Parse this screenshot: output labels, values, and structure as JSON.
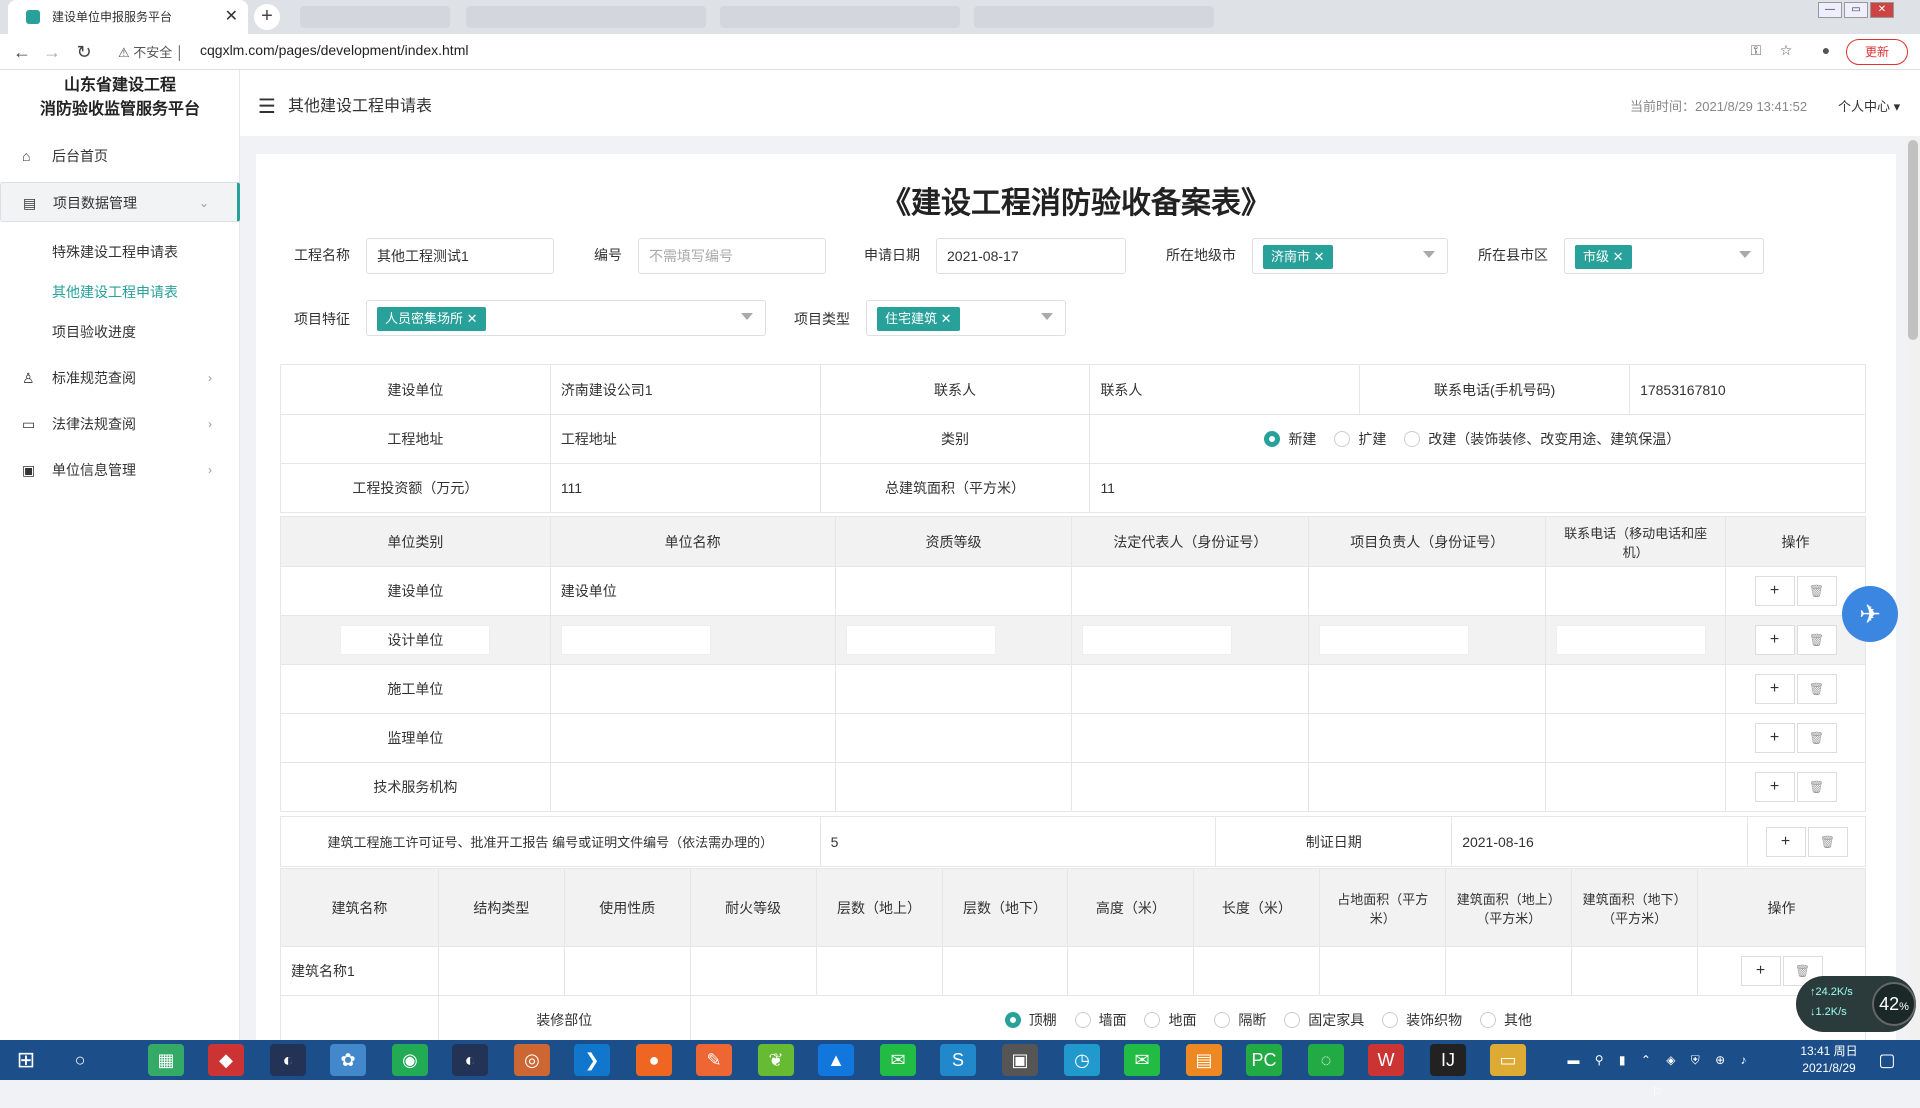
{
  "browser": {
    "tab_title": "建设单位申报服务平台",
    "secure_label": "不安全",
    "url": "cqgxlm.com/pages/development/index.html",
    "update_label": "更新"
  },
  "sidebar": {
    "logo_line1": "山东省建设工程",
    "logo_line2": "消防验收监管服务平台",
    "home": "后台首页",
    "project_mgmt": "项目数据管理",
    "sub_items": [
      "特殊建设工程申请表",
      "其他建设工程申请表",
      "项目验收进度"
    ],
    "standards": "标准规范查阅",
    "laws": "法律法规查阅",
    "unit_info": "单位信息管理"
  },
  "header": {
    "breadcrumb": "其他建设工程申请表",
    "time": "当前时间：2021/8/29 13:41:52",
    "user_menu": "个人中心 ▾"
  },
  "form": {
    "title": "《建设工程消防验收备案表》",
    "name_label": "工程名称",
    "name_value": "其他工程测试1",
    "no_label": "编号",
    "no_placeholder": "不需填写编号",
    "date_label": "申请日期",
    "date_value": "2021-08-17",
    "city_label": "所在地级市",
    "city_value": "济南市",
    "county_label": "所在县市区",
    "county_value": "市级",
    "feature_label": "项目特征",
    "feature_value": "人员密集场所",
    "type_label": "项目类型",
    "type_value": "住宅建筑"
  },
  "info_table": {
    "r1": [
      "建设单位",
      "济南建设公司1",
      "联系人",
      "联系人",
      "联系电话(手机号码)",
      "17853167810"
    ],
    "r2_label": "工程地址",
    "r2_value": "工程地址",
    "r2_cat": "类别",
    "radio_options": [
      "新建",
      "扩建",
      "改建（装饰装修、改变用途、建筑保温）"
    ],
    "r3": [
      "工程投资额（万元）",
      "111",
      "总建筑面积（平方米）",
      "11"
    ]
  },
  "unit_table": {
    "headers": [
      "单位类别",
      "单位名称",
      "资质等级",
      "法定代表人（身份证号）",
      "项目负责人（身份证号）",
      "联系电话（移动电话和座机）",
      "操作"
    ],
    "rows": [
      {
        "type": "建设单位",
        "name": "建设单位"
      },
      {
        "type": "设计单位",
        "name": ""
      },
      {
        "type": "施工单位",
        "name": ""
      },
      {
        "type": "监理单位",
        "name": ""
      },
      {
        "type": "技术服务机构",
        "name": ""
      }
    ],
    "permit_label": "建筑工程施工许可证号、批准开工报告 编号或证明文件编号（依法需办理的）",
    "permit_value": "5",
    "permit_date_label": "制证日期",
    "permit_date_value": "2021-08-16"
  },
  "building_table": {
    "headers": [
      "建筑名称",
      "结构类型",
      "使用性质",
      "耐火等级",
      "层数（地上）",
      "层数（地下）",
      "高度（米）",
      "长度（米）",
      "占地面积（平方米）",
      "建筑面积（地上）（平方米）",
      "建筑面积（地下）（平方米）",
      "操作"
    ],
    "row1_name": "建筑名称1",
    "deco_label": "装修部位",
    "deco_options": [
      "顶棚",
      "墙面",
      "地面",
      "隔断",
      "固定家具",
      "装饰织物",
      "其他"
    ]
  },
  "widgets": {
    "speed_pct": "42",
    "speed_pct_unit": "%",
    "up_speed": "24.2K/s",
    "down_speed": "1.2K/s"
  },
  "taskbar": {
    "time": "13:41 周日",
    "date": "2021/8/29"
  }
}
